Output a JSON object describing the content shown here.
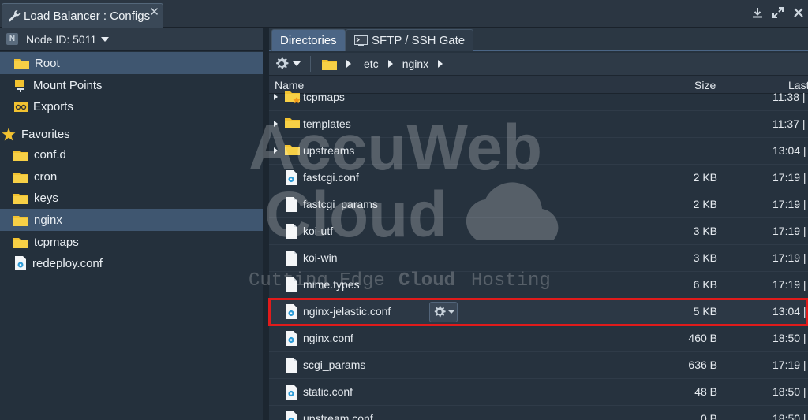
{
  "window": {
    "title": "Load Balancer : Configs",
    "close_glyph": "✕",
    "controls": [
      "download-icon",
      "expand-icon",
      "close-window-icon"
    ]
  },
  "left_panel": {
    "node_label": "Node ID: 5011",
    "items": [
      {
        "label": "Root",
        "icon": "folder-icon"
      },
      {
        "label": "Mount Points",
        "icon": "mount-points-icon"
      },
      {
        "label": "Exports",
        "icon": "exports-icon"
      }
    ],
    "favorites_label": "Favorites",
    "favorites": [
      {
        "label": "conf.d",
        "icon": "folder-icon"
      },
      {
        "label": "cron",
        "icon": "folder-icon"
      },
      {
        "label": "keys",
        "icon": "folder-icon"
      },
      {
        "label": "nginx",
        "icon": "folder-icon"
      },
      {
        "label": "tcpmaps",
        "icon": "folder-icon"
      },
      {
        "label": "redeploy.conf",
        "icon": "config-file-icon"
      }
    ]
  },
  "tabs": {
    "directories": "Directories",
    "sftp": "SFTP / SSH Gate"
  },
  "breadcrumb": {
    "parts": [
      "etc",
      "nginx"
    ]
  },
  "table": {
    "headers": {
      "name": "Name",
      "size": "Size",
      "last": "Last"
    },
    "rows": [
      {
        "name": "tcpmaps",
        "size": "",
        "date": "11:38 |",
        "type": "folder-star"
      },
      {
        "name": "templates",
        "size": "",
        "date": "11:37 |",
        "type": "folder"
      },
      {
        "name": "upstreams",
        "size": "",
        "date": "13:04 |",
        "type": "folder"
      },
      {
        "name": "fastcgi.conf",
        "size": "2 KB",
        "date": "17:19 |",
        "type": "conf"
      },
      {
        "name": "fastcgi_params",
        "size": "2 KB",
        "date": "17:19 |",
        "type": "file"
      },
      {
        "name": "koi-utf",
        "size": "3 KB",
        "date": "17:19 |",
        "type": "file"
      },
      {
        "name": "koi-win",
        "size": "3 KB",
        "date": "17:19 |",
        "type": "file"
      },
      {
        "name": "mime.types",
        "size": "6 KB",
        "date": "17:19 |",
        "type": "file"
      },
      {
        "name": "nginx-jelastic.conf",
        "size": "5 KB",
        "date": "13:04 |",
        "type": "conf"
      },
      {
        "name": "nginx.conf",
        "size": "460 B",
        "date": "18:50 |",
        "type": "conf"
      },
      {
        "name": "scgi_params",
        "size": "636 B",
        "date": "17:19 |",
        "type": "file"
      },
      {
        "name": "static.conf",
        "size": "48 B",
        "date": "18:50 |",
        "type": "conf"
      },
      {
        "name": "upstream.conf",
        "size": "0 B",
        "date": "18:50 |",
        "type": "conf"
      }
    ]
  },
  "watermark": {
    "line1": "AccuWeb",
    "line2": "Cloud",
    "tagline_left": "Cutting Edge",
    "tagline_mid": "Cloud",
    "tagline_right": "Hosting"
  },
  "colors": {
    "accent": "#4b6585",
    "highlight": "#e01b1b",
    "folder": "#f2c230"
  }
}
